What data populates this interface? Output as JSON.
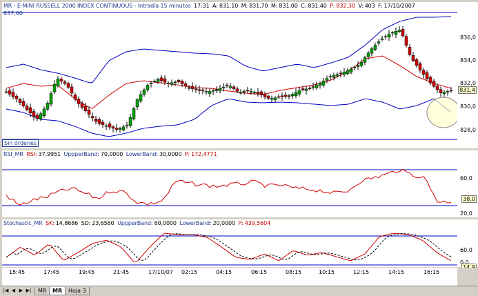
{
  "header": {
    "symbol": "MR - E-MINI RUSSELL 2000 INDEX CONTINUOUS - Intradía 15 minutos",
    "time": "17:31",
    "a_label": "A:",
    "a_value": "831,10",
    "m_label": "M:",
    "m_value": "831,70",
    "mi_label": "M:",
    "mi_value": "831,00",
    "c_label": "C:",
    "c_value": "831,40",
    "p_label": "P:",
    "p_value": "832,30",
    "v_label": "V:",
    "v_value": "403",
    "f_label": "F:",
    "f_value": "17/10/2007",
    "scale_top": "837,60"
  },
  "price_axis": [
    "836,0",
    "834,0",
    "832,0",
    "830,0",
    "828,0"
  ],
  "price_tag": "831,4",
  "order_button": "Sin órdenes",
  "rsi": {
    "title": "RSI_MR",
    "rsi_label": "RSI:",
    "rsi_value": "37,9951",
    "upper_label": "UppperBand:",
    "upper_value": "70,0000",
    "lower_label": "LowerBand:",
    "lower_value": "30,0000",
    "p_label": "P:",
    "p_value": "172,4771",
    "axis": [
      "60,0",
      "20,0"
    ],
    "tag": "38,0"
  },
  "stoch": {
    "title": "Stochastic_MR",
    "sk_label": "SK:",
    "sk_value": "14,8686",
    "sd_label": "SD:",
    "sd_value": "23,6560",
    "upper_label": "UppperBand:",
    "upper_value": "80,0000",
    "lower_label": "LowerBand:",
    "lower_value": "20,0000",
    "p_label": "P:",
    "p_value": "439,5604",
    "axis": [
      "60,0",
      "0,0"
    ],
    "tag": "14,9"
  },
  "time_labels": [
    "15:45",
    "17:45",
    "19:45",
    "21:45",
    "17/10/07",
    "02:15",
    "04:15",
    "06:15",
    "08:15",
    "10:15",
    "12:15",
    "14:15",
    "16:15"
  ],
  "tabs": [
    "MR",
    "Hoja 3"
  ],
  "colors": {
    "up": "#00a000",
    "down": "#d00000",
    "band": "#0000c0",
    "ma": "#d00000",
    "grid": "#000080"
  }
}
